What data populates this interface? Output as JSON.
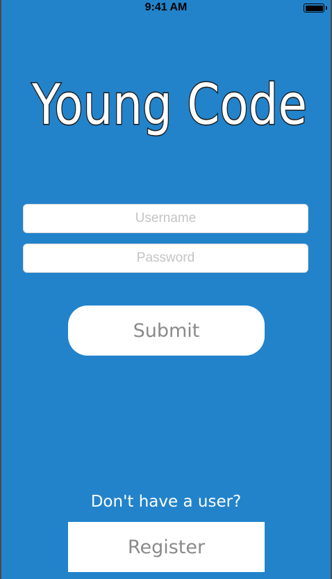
{
  "status_bar": {
    "time": "9:41 AM",
    "battery_icon": "battery-full-icon",
    "battery_level": 1.0
  },
  "logo": {
    "text": "Young Code"
  },
  "form": {
    "username_placeholder": "Username",
    "username_value": "",
    "password_placeholder": "Password",
    "password_value": "",
    "submit_label": "Submit"
  },
  "footer": {
    "prompt": "Don't have a user?",
    "register_label": "Register"
  },
  "colors": {
    "background": "#2283cb",
    "button_background": "#ffffff",
    "button_text": "#8a8a8a",
    "placeholder": "#c4c4c4"
  }
}
